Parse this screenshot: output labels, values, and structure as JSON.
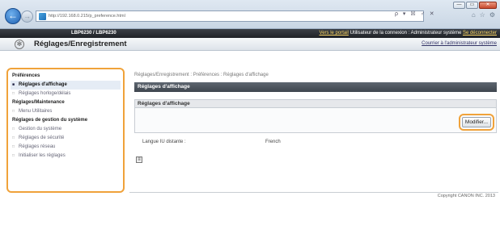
{
  "browser": {
    "url": "http://192.168.0.215/p_preference.html",
    "win_minimize": "—",
    "win_maximize": "▭",
    "win_close": "✕",
    "addr_tools": "ρ ▾ ☒ ♂ ✕",
    "icons": [
      "home-icon",
      "star-icon",
      "gear-icon"
    ]
  },
  "topbar": {
    "model": "LBP6230 / LBP6230",
    "portal_link": "Vers le portail",
    "user_text": "Utilisateur de la connexion : Administrateur système",
    "logout_link": "Se déconnecter"
  },
  "titlebar": {
    "title": "Réglages/Enregistrement",
    "admin_link": "Courrier à l'administrateur système"
  },
  "sidebar": {
    "groups": [
      {
        "heading": "Préférences",
        "items": [
          "Réglages d'affichage",
          "Réglages horloge/délais"
        ]
      },
      {
        "heading": "Réglages/Maintenance",
        "items": [
          "Menu Utilitaires"
        ]
      },
      {
        "heading": "Réglages de gestion du système",
        "items": [
          "Gestion du système",
          "Réglages de sécurité",
          "Réglages réseau",
          "Initialiser les réglages"
        ]
      }
    ],
    "selected": "Réglages d'affichage"
  },
  "main": {
    "breadcrumb": "Réglages/Enregistrement : Préférences : Réglages d'affichage",
    "page_header": "Réglages d'affichage",
    "section_header": "Réglages d'affichage",
    "modify_button": "Modifier...",
    "field_label": "Langue IU distante :",
    "field_value": "French",
    "copyright": "Copyright CANON INC. 2013"
  }
}
